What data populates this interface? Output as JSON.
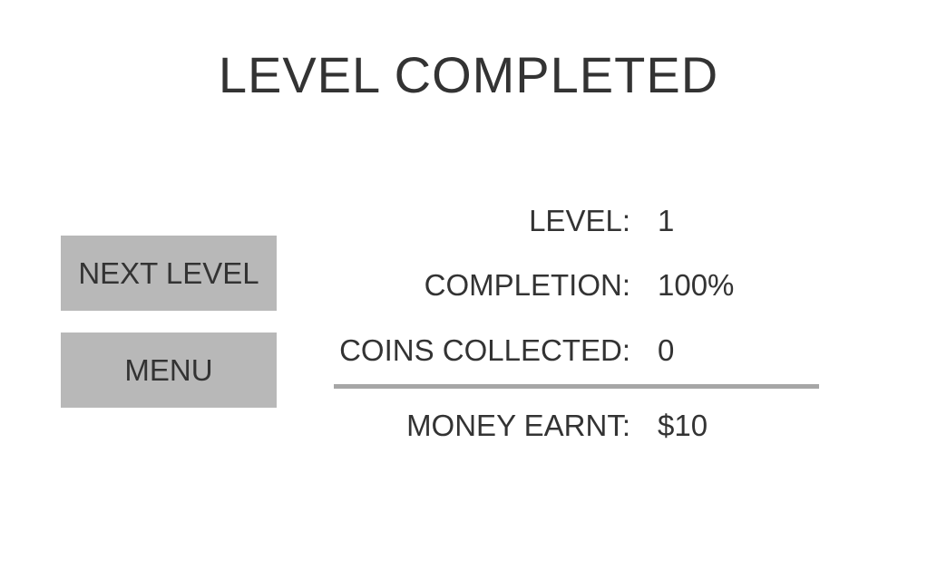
{
  "title": "LEVEL COMPLETED",
  "buttons": {
    "next_level": "NEXT LEVEL",
    "menu": "MENU"
  },
  "stats": [
    {
      "label": "LEVEL:",
      "value": "1"
    },
    {
      "label": "COMPLETION:",
      "value": "100%"
    },
    {
      "label": "COINS COLLECTED:",
      "value": "0"
    }
  ],
  "total": {
    "label": "MONEY EARNT:",
    "value": "$10"
  },
  "colors": {
    "background": "#ffffff",
    "text": "#333333",
    "button": "#b8b8b8",
    "divider": "#a6a6a6"
  }
}
